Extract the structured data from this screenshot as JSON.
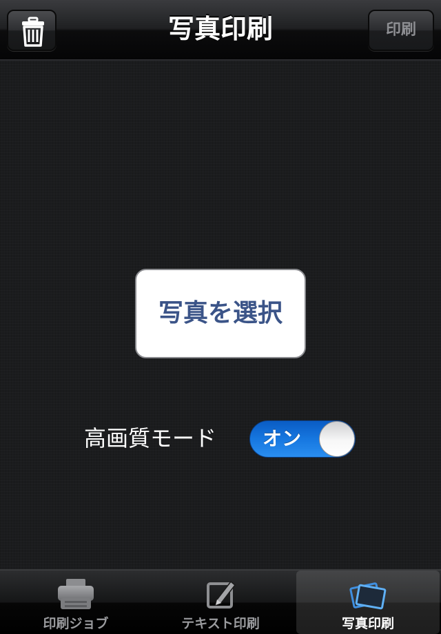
{
  "navbar": {
    "title": "写真印刷",
    "trash_icon": "trash-icon",
    "print_label": "印刷"
  },
  "main": {
    "select_photo_label": "写真を選択",
    "high_quality_label": "高画質モード",
    "high_quality_toggle": {
      "state": "on",
      "label": "オン",
      "accent": "#1677e0"
    }
  },
  "tabbar": {
    "tabs": [
      {
        "label": "印刷ジョブ",
        "icon": "printer-icon",
        "selected": false
      },
      {
        "label": "テキスト印刷",
        "icon": "edit-icon",
        "selected": false
      },
      {
        "label": "写真印刷",
        "icon": "photos-icon",
        "selected": true
      }
    ],
    "selected_color": "#ffffff",
    "unselected_color": "#9a9b9e",
    "selected_icon_color": "#4aa3f0"
  }
}
